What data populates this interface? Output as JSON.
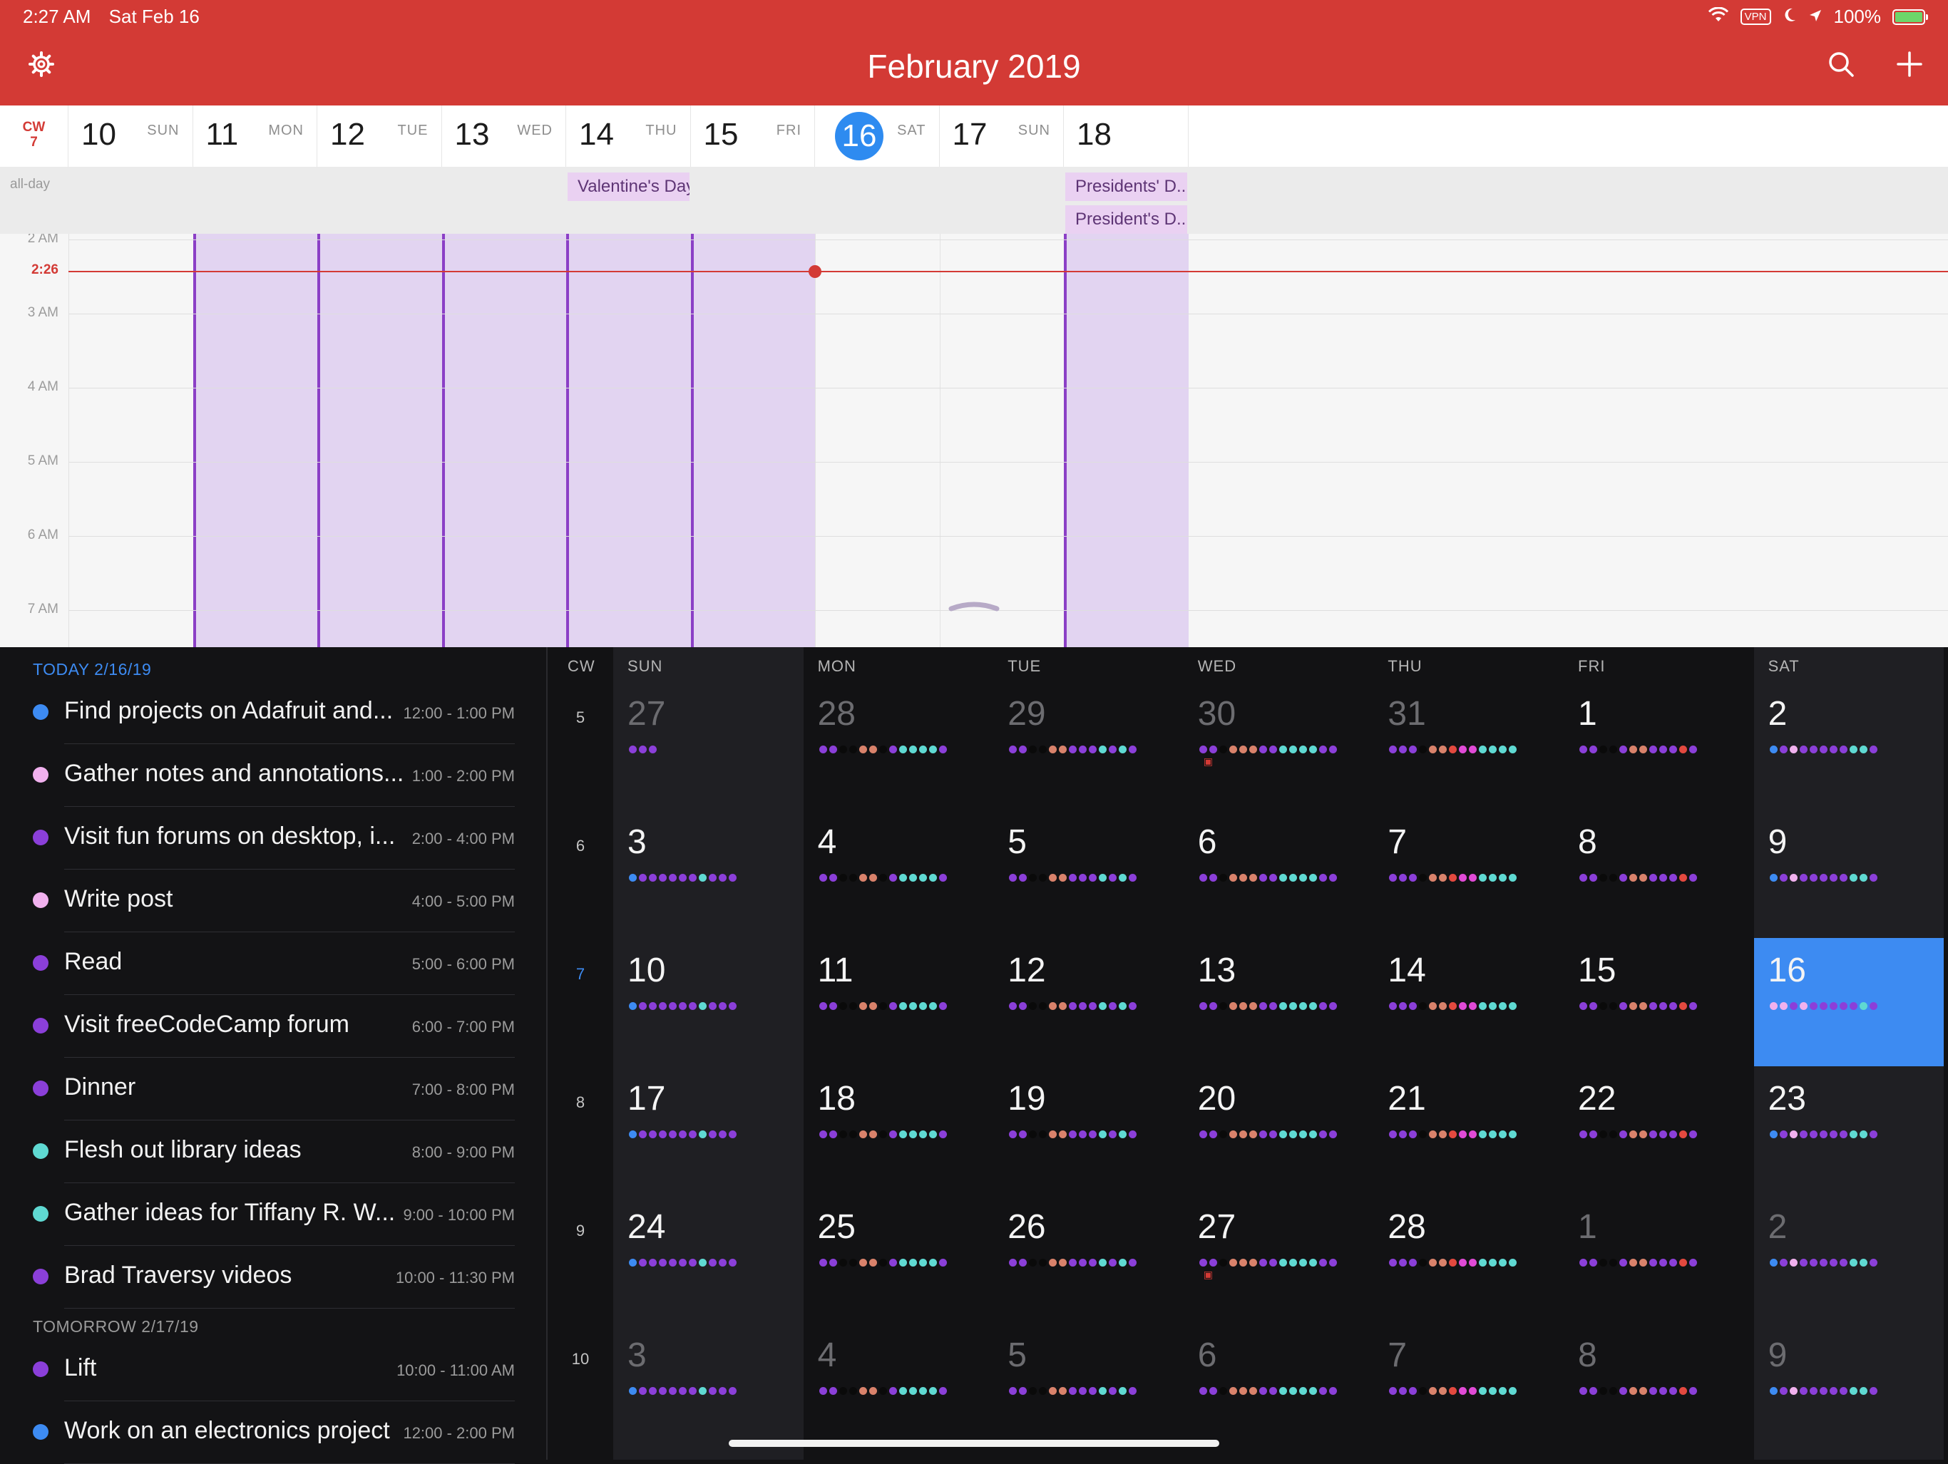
{
  "status_bar": {
    "time": "2:27 AM",
    "date": "Sat Feb 16",
    "vpn": "VPN",
    "battery": "100%",
    "battery_level": 1.0
  },
  "header": {
    "title": "February 2019",
    "icons": [
      "gear-icon",
      "search-icon",
      "plus-icon"
    ],
    "color": "#d33a35"
  },
  "week_view": {
    "cw_label": "CW",
    "cw_number": "7",
    "days": [
      {
        "num": "10",
        "dow": "SUN"
      },
      {
        "num": "11",
        "dow": "MON"
      },
      {
        "num": "12",
        "dow": "TUE"
      },
      {
        "num": "13",
        "dow": "WED"
      },
      {
        "num": "14",
        "dow": "THU"
      },
      {
        "num": "15",
        "dow": "FRI"
      },
      {
        "num": "16",
        "dow": "SAT",
        "today": true
      },
      {
        "num": "17",
        "dow": "SUN"
      },
      {
        "num": "18",
        "dow": ""
      }
    ],
    "allday_label": "all-day",
    "allday_events": [
      {
        "title": "Valentine's Day",
        "day": "14"
      },
      {
        "title": "Presidents' D...",
        "day": "18"
      },
      {
        "title": "President's D...",
        "day": "18"
      }
    ],
    "hours": [
      "2 AM",
      "3 AM",
      "4 AM",
      "5 AM",
      "6 AM",
      "7 AM"
    ],
    "now_label": "2:26"
  },
  "agenda": {
    "sections": [
      {
        "label": "TODAY",
        "date": "2/16/19",
        "items": [
          {
            "title": "Find projects on Adafruit and...",
            "time": "12:00 - 1:00 PM",
            "color": "#3d8bf2"
          },
          {
            "title": "Gather notes and annotations...",
            "time": "1:00 - 2:00 PM",
            "color": "#f1b1ee"
          },
          {
            "title": "Visit fun forums on desktop, i...",
            "time": "2:00 - 4:00 PM",
            "color": "#8b3fd9"
          },
          {
            "title": "Write post",
            "time": "4:00 - 5:00 PM",
            "color": "#f1b1ee"
          },
          {
            "title": "Read",
            "time": "5:00 - 6:00 PM",
            "color": "#8b3fd9"
          },
          {
            "title": "Visit freeCodeCamp forum",
            "time": "6:00 - 7:00 PM",
            "color": "#8b3fd9"
          },
          {
            "title": "Dinner",
            "time": "7:00 - 8:00 PM",
            "color": "#8b3fd9"
          },
          {
            "title": "Flesh out library ideas",
            "time": "8:00 - 9:00 PM",
            "color": "#5fd9d2"
          },
          {
            "title": "Gather ideas for Tiffany R. W...",
            "time": "9:00 - 10:00 PM",
            "color": "#5fd9d2"
          },
          {
            "title": "Brad Traversy videos",
            "time": "10:00 - 11:30 PM",
            "color": "#8b3fd9"
          }
        ]
      },
      {
        "label": "TOMORROW",
        "date": "2/17/19",
        "items": [
          {
            "title": "Lift",
            "time": "10:00 - 11:00 AM",
            "color": "#8b3fd9"
          },
          {
            "title": "Work on an electronics project",
            "time": "12:00 - 2:00 PM",
            "color": "#3d8bf2"
          }
        ]
      }
    ]
  },
  "month_view": {
    "headers": [
      "CW",
      "SUN",
      "MON",
      "TUE",
      "WED",
      "THU",
      "FRI",
      "SAT"
    ],
    "weeks": [
      {
        "cw": "5",
        "days": [
          {
            "n": "27",
            "other": true
          },
          {
            "n": "28",
            "other": true
          },
          {
            "n": "29",
            "other": true
          },
          {
            "n": "30",
            "other": true,
            "gift": true
          },
          {
            "n": "31",
            "other": true
          },
          {
            "n": "1"
          },
          {
            "n": "2"
          }
        ]
      },
      {
        "cw": "6",
        "days": [
          {
            "n": "3"
          },
          {
            "n": "4"
          },
          {
            "n": "5"
          },
          {
            "n": "6"
          },
          {
            "n": "7"
          },
          {
            "n": "8"
          },
          {
            "n": "9"
          }
        ]
      },
      {
        "cw": "7",
        "current": true,
        "days": [
          {
            "n": "10"
          },
          {
            "n": "11"
          },
          {
            "n": "12"
          },
          {
            "n": "13"
          },
          {
            "n": "14"
          },
          {
            "n": "15"
          },
          {
            "n": "16",
            "today": true
          }
        ]
      },
      {
        "cw": "8",
        "days": [
          {
            "n": "17"
          },
          {
            "n": "18"
          },
          {
            "n": "19"
          },
          {
            "n": "20"
          },
          {
            "n": "21"
          },
          {
            "n": "22"
          },
          {
            "n": "23"
          }
        ]
      },
      {
        "cw": "9",
        "days": [
          {
            "n": "24"
          },
          {
            "n": "25"
          },
          {
            "n": "26"
          },
          {
            "n": "27",
            "gift": true
          },
          {
            "n": "28"
          },
          {
            "n": "1",
            "other": true
          },
          {
            "n": "2",
            "other": true
          }
        ]
      },
      {
        "cw": "10",
        "days": [
          {
            "n": "3",
            "other": true
          },
          {
            "n": "4",
            "other": true
          },
          {
            "n": "5",
            "other": true
          },
          {
            "n": "6",
            "other": true
          },
          {
            "n": "7",
            "other": true
          },
          {
            "n": "8",
            "other": true
          },
          {
            "n": "9",
            "other": true
          }
        ]
      }
    ],
    "dot_colors": {
      "p": "#8b3fd9",
      "k": "#0a0a0a",
      "o": "#d9826b",
      "c": "#5fd9d2",
      "b": "#3d8bf2",
      "i": "#f1b1ee",
      "m": "#e04ad6",
      "r": "#e3493f",
      "w": "#ffffff"
    },
    "dot_patterns": {
      "sun": "ppp",
      "sunb": "bppppppcppp",
      "mon": "ppkkookpccccp",
      "tue": "ppkkoopppcpcp",
      "wed": "ppkoooppccccpp",
      "thu": "pppkoormmcccc",
      "fri": "ppkkpooppprp",
      "sat": "bpipppppccp",
      "today": "iipipppppcp"
    }
  }
}
